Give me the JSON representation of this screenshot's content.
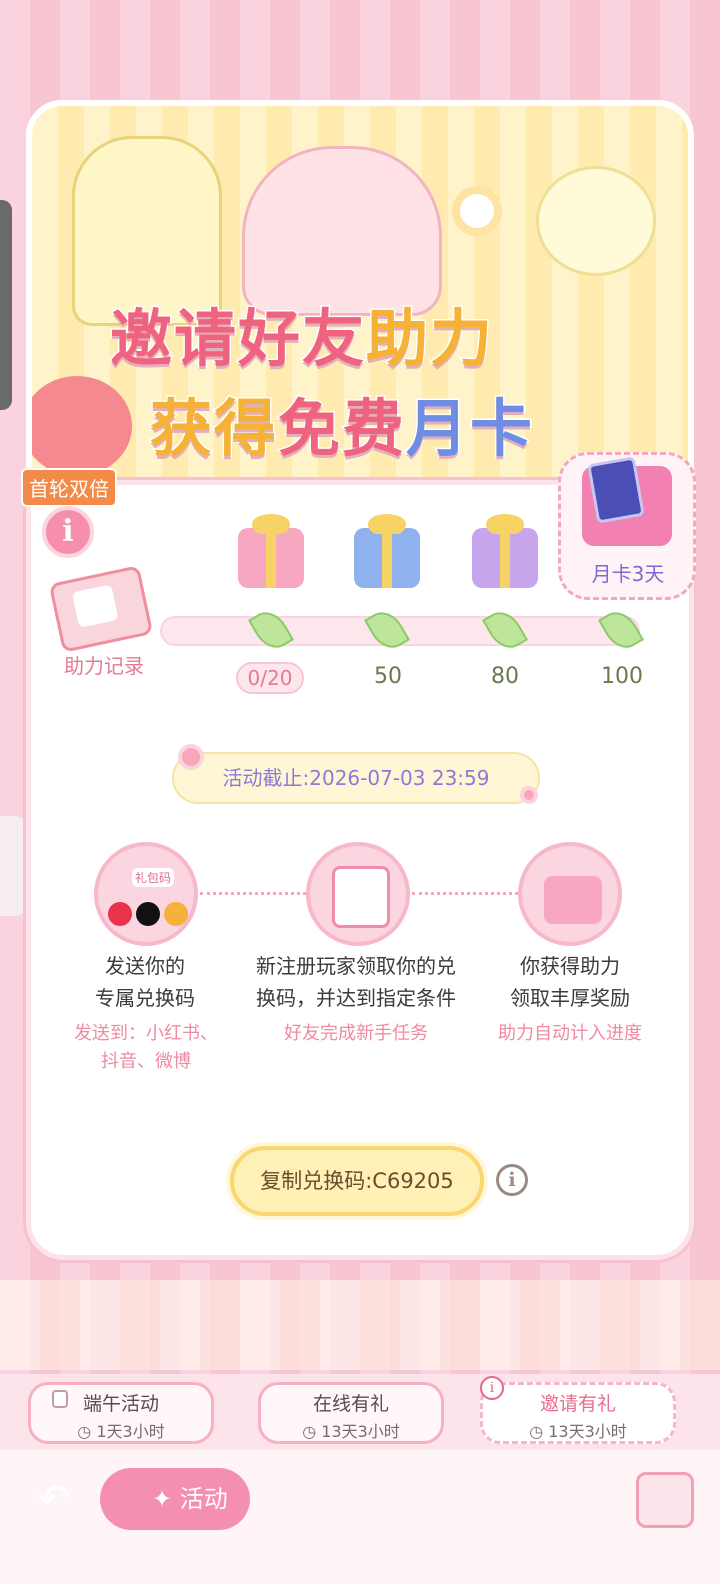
{
  "banner": {
    "line1_a": "邀请好友",
    "line1_b": "助力",
    "line2_a": "获得",
    "line2_b": "免费",
    "line2_c": "月卡",
    "first_round_badge": "首轮双倍"
  },
  "progress": {
    "record_label": "助力记录",
    "current": "0/20",
    "milestones": [
      "50",
      "80",
      "100"
    ],
    "current_value": 0,
    "final_reward_label": "月卡3天"
  },
  "deadline": "活动截止:2026-07-03 23:59",
  "steps": [
    {
      "title_line1": "发送你的",
      "title_line2": "专属兑换码",
      "sub_line1": "发送到：小红书、",
      "sub_line2": "抖音、微博"
    },
    {
      "title_line1": "新注册玩家领取你的兑",
      "title_line2": "换码，并达到指定条件",
      "sub_line1": "好友完成新手任务",
      "sub_line2": ""
    },
    {
      "title_line1": "你获得助力",
      "title_line2": "领取丰厚奖励",
      "sub_line1": "助力自动计入进度",
      "sub_line2": ""
    }
  ],
  "step1_icon_text": "礼包码",
  "copy_button": "复制兑换码:C69205",
  "tabs": [
    {
      "name": "端午活动",
      "time": "1天3小时"
    },
    {
      "name": "在线有礼",
      "time": "13天3小时"
    },
    {
      "name": "邀请有礼",
      "time": "13天3小时"
    }
  ],
  "bottom": {
    "activity_label": "✦ 活动"
  },
  "colors": {
    "accent_pink": "#f58fab",
    "title_yellow": "#f5b235",
    "title_blue": "#6f8de2",
    "deadline_text": "#8b7bd8"
  }
}
